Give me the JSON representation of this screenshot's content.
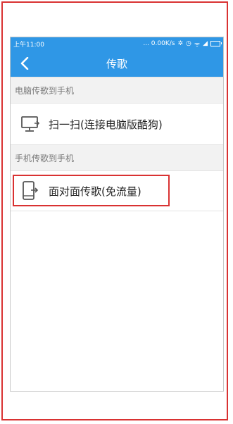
{
  "colors": {
    "accent": "#2f97e6",
    "highlight": "#d93232"
  },
  "status_bar": {
    "time": "上午11:00",
    "speed": "... 0.00K/s"
  },
  "app_bar": {
    "title": "传歌",
    "back_icon": "chevron-left-icon"
  },
  "sections": [
    {
      "header": "电脑传歌到手机",
      "item": {
        "label": "扫一扫(连接电脑版酷狗)",
        "icon": "monitor-icon"
      }
    },
    {
      "header": "手机传歌到手机",
      "item": {
        "label": "面对面传歌(免流量)",
        "icon": "phone-transfer-icon"
      }
    }
  ]
}
